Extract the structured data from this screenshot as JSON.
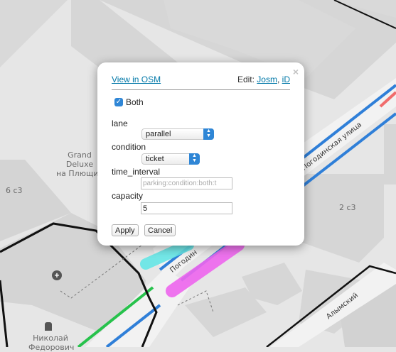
{
  "map": {
    "labels": {
      "building_grand": "Grand\nDeluxe\nна Плющих",
      "building_6c3": "6 с3",
      "building_2c3": "2 с3",
      "street_pogodinskaya": "Погодинская улица",
      "street_pogodin": "Погодин",
      "street_bottom_right": "Алымский",
      "poi_nikolay": "Николай\nФедорович"
    }
  },
  "popup": {
    "view_link": "View in OSM",
    "edit_prefix": "Edit:",
    "edit_josm": "Josm",
    "edit_sep": ",",
    "edit_id": "iD",
    "close_glyph": "×",
    "both_label": "Both",
    "both_checked": true,
    "fields": {
      "lane_label": "lane",
      "lane_value": "parallel",
      "condition_label": "condition",
      "condition_value": "ticket",
      "time_interval_label": "time_interval",
      "time_interval_placeholder": "parking:condition:both:t",
      "capacity_label": "capacity",
      "capacity_value": "5"
    },
    "apply_label": "Apply",
    "cancel_label": "Cancel"
  },
  "colors": {
    "road_blue": "#2f7fd8",
    "road_green": "#27c24c",
    "highlight_magenta": "#ee66ee",
    "highlight_cyan": "#66e6e6",
    "road_red": "#f06c6c",
    "link": "#0078a8",
    "checkbox_blue": "#2f86d6"
  },
  "icons": {
    "medical": "medical-cross-icon",
    "memorial": "memorial-icon",
    "close": "close-icon",
    "check": "check-icon",
    "chevron": "chevron-updown-icon"
  }
}
